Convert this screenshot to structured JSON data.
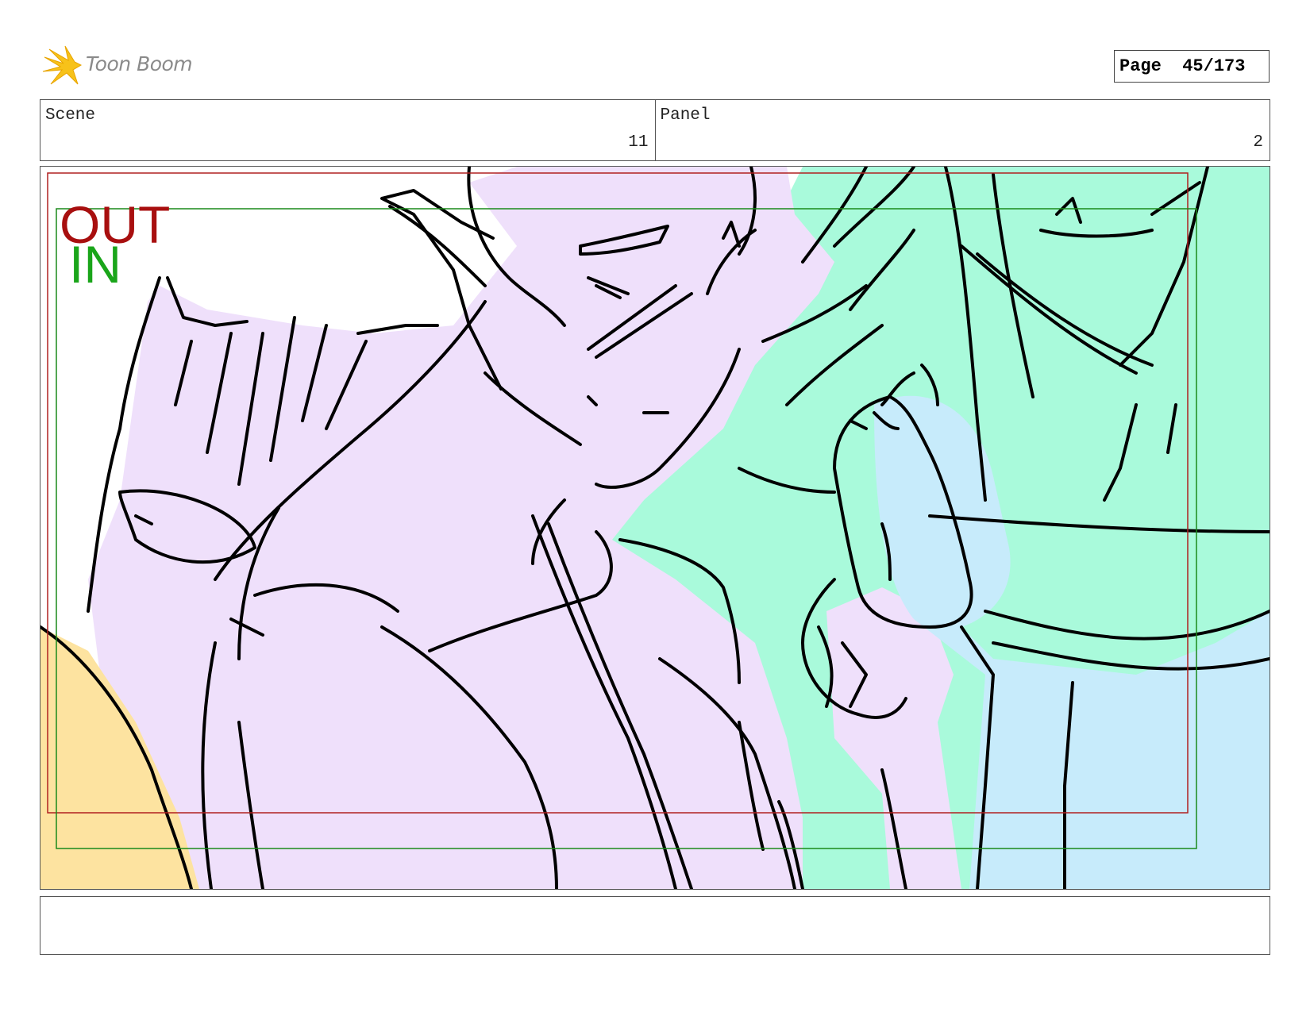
{
  "app": {
    "logo_text": "Toon Boom"
  },
  "page": {
    "label": "Page",
    "number": "45/173"
  },
  "scene": {
    "label": "Scene",
    "value": "11"
  },
  "panel": {
    "label": "Panel",
    "value": "2"
  },
  "overlay": {
    "out_label": "OUT",
    "in_label": "IN"
  },
  "colors": {
    "out_frame": "#b02020",
    "in_frame": "#1a8a1a",
    "elf_skin": "#efe0fb",
    "hair": "#a9fadb",
    "creature": "#c7ebfb",
    "orange": "#fde3a0"
  },
  "notes": {
    "text": ""
  }
}
